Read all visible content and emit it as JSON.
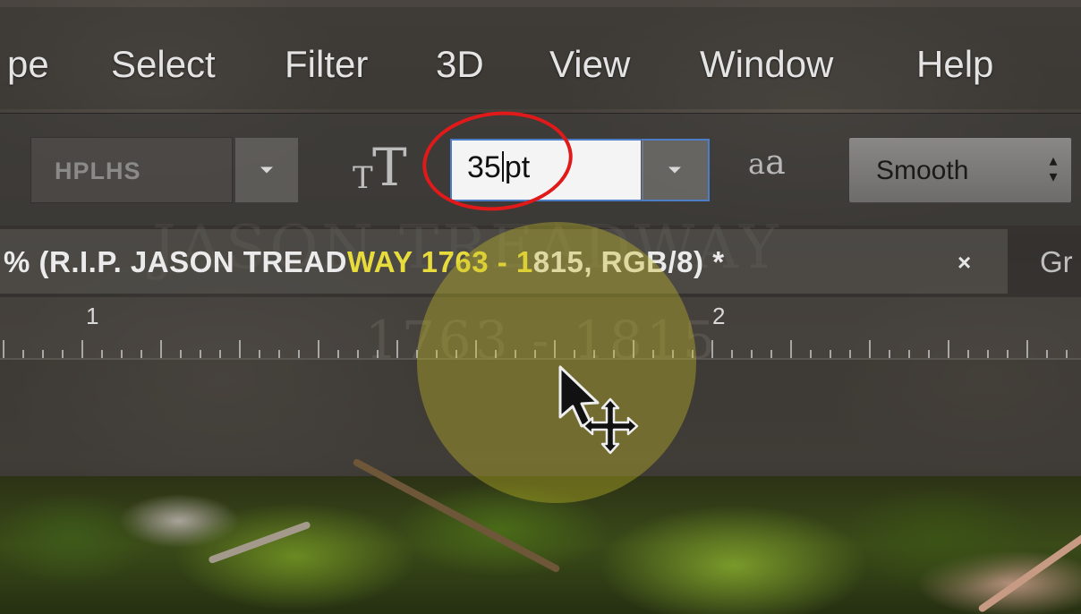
{
  "menubar": {
    "items": [
      {
        "label": "pe"
      },
      {
        "label": "Select"
      },
      {
        "label": "Filter"
      },
      {
        "label": "3D"
      },
      {
        "label": "View"
      },
      {
        "label": "Window"
      },
      {
        "label": "Help"
      }
    ]
  },
  "options_bar": {
    "font_family": "HPLHS",
    "font_size_value": "35",
    "font_size_unit": "pt",
    "antialias_icon_small": "a",
    "antialias_icon_large": "a",
    "antialias_value": "Smooth"
  },
  "document_tab": {
    "title_before": "% (R.I.P. JASON  TREAD",
    "title_highlight": "WAY 1763 - 1",
    "title_after": "815, RGB/8) *",
    "close_label": "×",
    "next_tab_label": "Gr"
  },
  "ruler": {
    "marks": [
      "1",
      "2"
    ]
  },
  "background_text": {
    "line1": "JASON TREADWAY",
    "line2": "1763 - 1815"
  },
  "colors": {
    "accent_blue": "#4d7dc7",
    "annotation_red": "#e01a1a",
    "highlight_yellow": "#e8dc3c"
  }
}
